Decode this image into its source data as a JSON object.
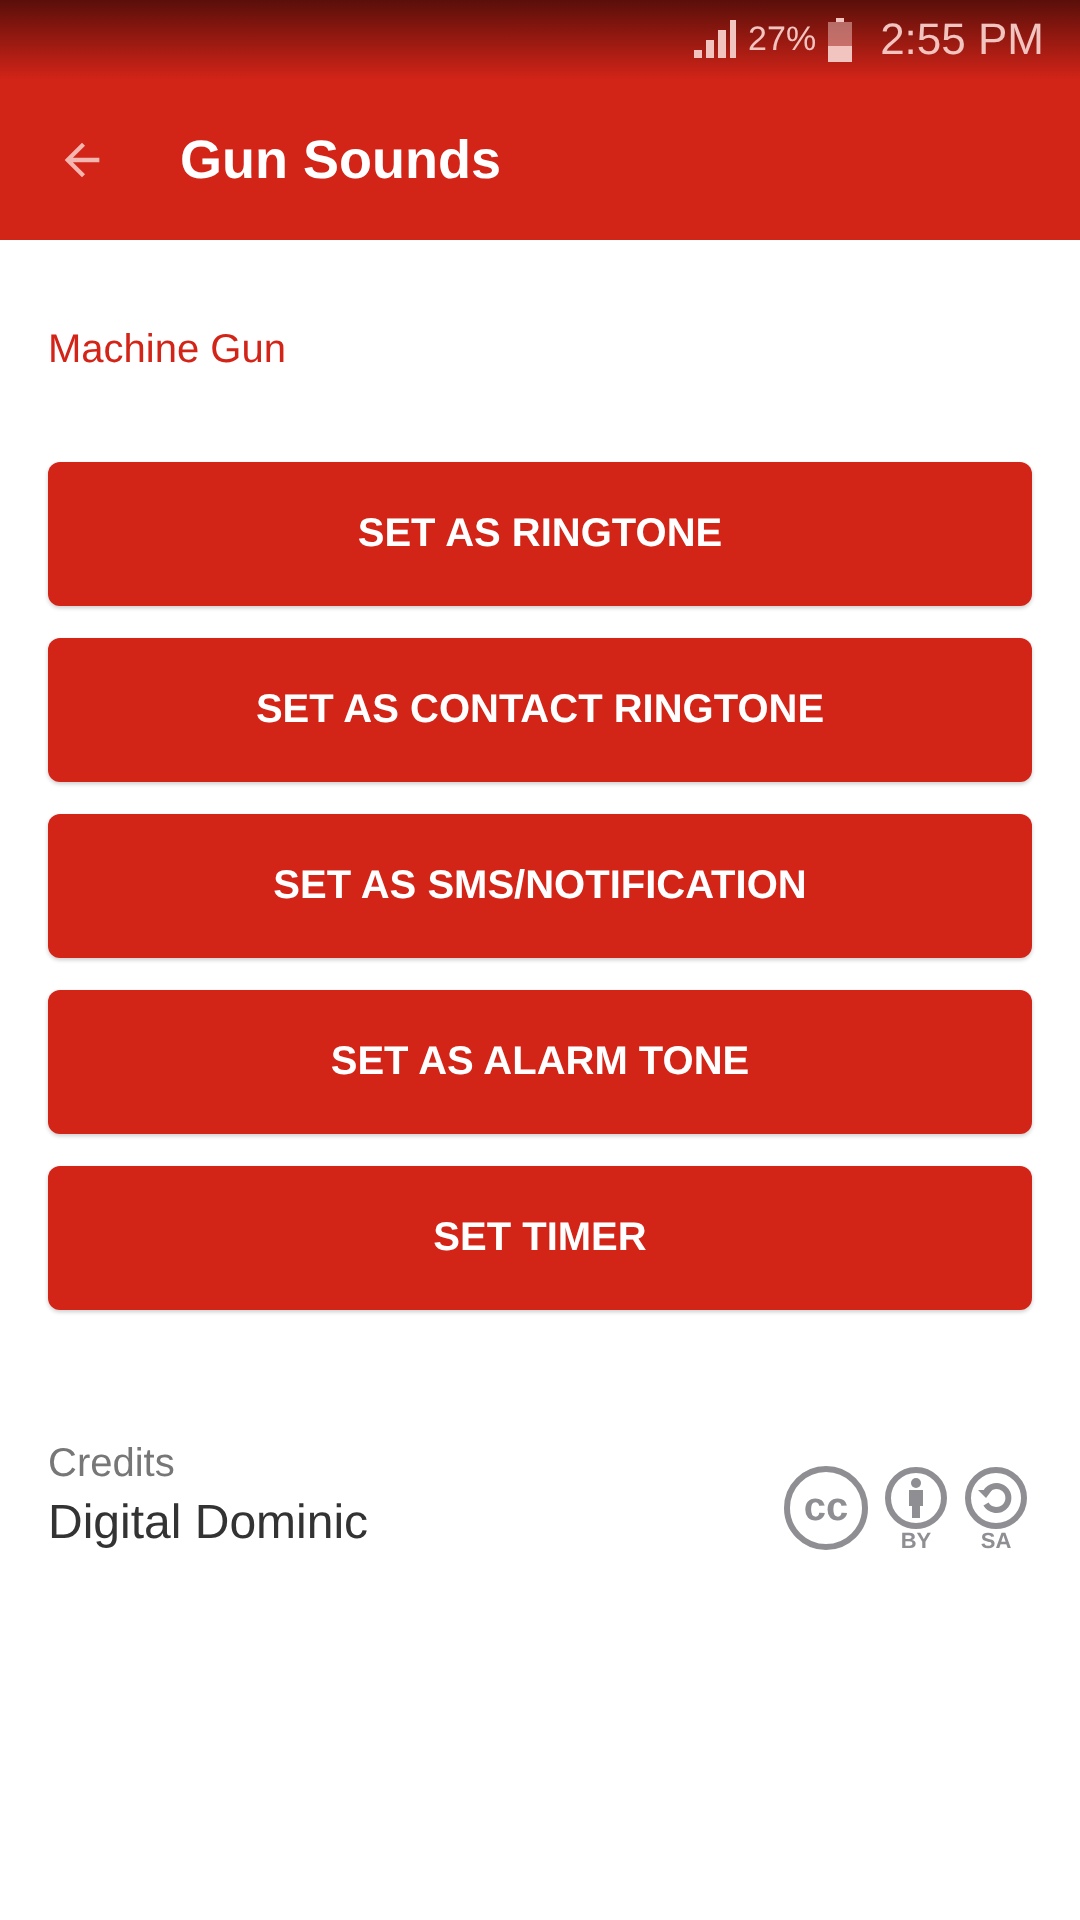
{
  "status_bar": {
    "battery": "27%",
    "time": "2:55 PM"
  },
  "app_bar": {
    "title": "Gun Sounds"
  },
  "sound_name": "Machine Gun",
  "buttons": [
    "SET AS RINGTONE",
    "SET AS CONTACT RINGTONE",
    "SET AS SMS/NOTIFICATION",
    "SET AS ALARM TONE",
    "SET TIMER"
  ],
  "credits": {
    "label": "Credits",
    "author": "Digital Dominic",
    "license_marks": [
      {
        "kind": "cc",
        "text": "cc"
      },
      {
        "kind": "by",
        "text": "BY"
      },
      {
        "kind": "sa",
        "text": "SA"
      }
    ]
  }
}
